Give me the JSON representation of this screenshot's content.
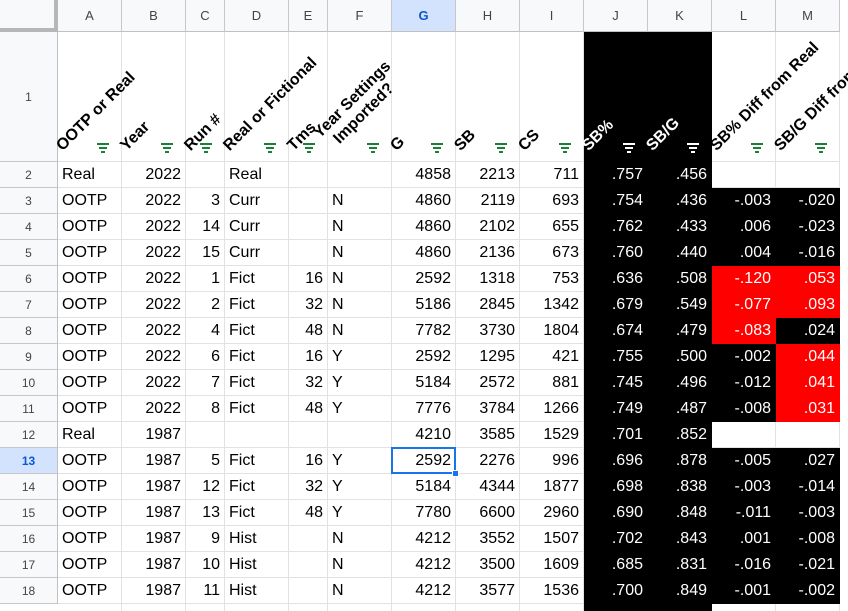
{
  "columns": [
    "A",
    "B",
    "C",
    "D",
    "E",
    "F",
    "G",
    "H",
    "I",
    "J",
    "K",
    "L",
    "M"
  ],
  "active_column": "G",
  "active_row": "13",
  "header_row_number": "1",
  "headers": [
    {
      "col": "A",
      "l1": "OOTP or Real",
      "l2": ""
    },
    {
      "col": "B",
      "l1": "Year",
      "l2": ""
    },
    {
      "col": "C",
      "l1": "Run #",
      "l2": ""
    },
    {
      "col": "D",
      "l1": "Real or Fictional",
      "l2": ""
    },
    {
      "col": "E",
      "l1": "Tms",
      "l2": ""
    },
    {
      "col": "F",
      "l1": "Year Settings",
      "l2": "Imported?"
    },
    {
      "col": "G",
      "l1": "G",
      "l2": ""
    },
    {
      "col": "H",
      "l1": "SB",
      "l2": ""
    },
    {
      "col": "I",
      "l1": "CS",
      "l2": ""
    },
    {
      "col": "J",
      "l1": "SB%",
      "l2": ""
    },
    {
      "col": "K",
      "l1": "SB/G",
      "l2": ""
    },
    {
      "col": "L",
      "l1": "SB% Diff from Real",
      "l2": ""
    },
    {
      "col": "M",
      "l1": "SB/G Diff from Real",
      "l2": ""
    }
  ],
  "rows": [
    {
      "num": "2",
      "cells": [
        "Real",
        "2022",
        "",
        "Real",
        "",
        "",
        "4858",
        "2213",
        "711",
        ".757",
        ".456",
        "",
        ""
      ]
    },
    {
      "num": "3",
      "cells": [
        "OOTP",
        "2022",
        "3",
        "Curr",
        "",
        "N",
        "4860",
        "2119",
        "693",
        ".754",
        ".436",
        "-.003",
        "-.020"
      ]
    },
    {
      "num": "4",
      "cells": [
        "OOTP",
        "2022",
        "14",
        "Curr",
        "",
        "N",
        "4860",
        "2102",
        "655",
        ".762",
        ".433",
        ".006",
        "-.023"
      ]
    },
    {
      "num": "5",
      "cells": [
        "OOTP",
        "2022",
        "15",
        "Curr",
        "",
        "N",
        "4860",
        "2136",
        "673",
        ".760",
        ".440",
        ".004",
        "-.016"
      ]
    },
    {
      "num": "6",
      "cells": [
        "OOTP",
        "2022",
        "1",
        "Fict",
        "16",
        "N",
        "2592",
        "1318",
        "753",
        ".636",
        ".508",
        "-.120",
        ".053"
      ]
    },
    {
      "num": "7",
      "cells": [
        "OOTP",
        "2022",
        "2",
        "Fict",
        "32",
        "N",
        "5186",
        "2845",
        "1342",
        ".679",
        ".549",
        "-.077",
        ".093"
      ]
    },
    {
      "num": "8",
      "cells": [
        "OOTP",
        "2022",
        "4",
        "Fict",
        "48",
        "N",
        "7782",
        "3730",
        "1804",
        ".674",
        ".479",
        "-.083",
        ".024"
      ]
    },
    {
      "num": "9",
      "cells": [
        "OOTP",
        "2022",
        "6",
        "Fict",
        "16",
        "Y",
        "2592",
        "1295",
        "421",
        ".755",
        ".500",
        "-.002",
        ".044"
      ]
    },
    {
      "num": "10",
      "cells": [
        "OOTP",
        "2022",
        "7",
        "Fict",
        "32",
        "Y",
        "5184",
        "2572",
        "881",
        ".745",
        ".496",
        "-.012",
        ".041"
      ]
    },
    {
      "num": "11",
      "cells": [
        "OOTP",
        "2022",
        "8",
        "Fict",
        "48",
        "Y",
        "7776",
        "3784",
        "1266",
        ".749",
        ".487",
        "-.008",
        ".031"
      ]
    },
    {
      "num": "12",
      "cells": [
        "Real",
        "1987",
        "",
        "",
        "",
        "",
        "4210",
        "3585",
        "1529",
        ".701",
        ".852",
        "",
        ""
      ]
    },
    {
      "num": "13",
      "cells": [
        "OOTP",
        "1987",
        "5",
        "Fict",
        "16",
        "Y",
        "2592",
        "2276",
        "996",
        ".696",
        ".878",
        "-.005",
        ".027"
      ]
    },
    {
      "num": "14",
      "cells": [
        "OOTP",
        "1987",
        "12",
        "Fict",
        "32",
        "Y",
        "5184",
        "4344",
        "1877",
        ".698",
        ".838",
        "-.003",
        "-.014"
      ]
    },
    {
      "num": "15",
      "cells": [
        "OOTP",
        "1987",
        "13",
        "Fict",
        "48",
        "Y",
        "7780",
        "6600",
        "2960",
        ".690",
        ".848",
        "-.011",
        "-.003"
      ]
    },
    {
      "num": "16",
      "cells": [
        "OOTP",
        "1987",
        "9",
        "Hist",
        "",
        "N",
        "4212",
        "3552",
        "1507",
        ".702",
        ".843",
        ".001",
        "-.008"
      ]
    },
    {
      "num": "17",
      "cells": [
        "OOTP",
        "1987",
        "10",
        "Hist",
        "",
        "N",
        "4212",
        "3500",
        "1609",
        ".685",
        ".831",
        "-.016",
        "-.021"
      ]
    },
    {
      "num": "18",
      "cells": [
        "OOTP",
        "1987",
        "11",
        "Hist",
        "",
        "N",
        "4212",
        "3577",
        "1536",
        ".700",
        ".849",
        "-.001",
        "-.002"
      ]
    }
  ],
  "red_cells": [
    "6:L",
    "6:M",
    "7:L",
    "7:M",
    "8:L",
    "9:M",
    "10:M",
    "11:M"
  ],
  "colors": {
    "black_fill": "#000000",
    "red_fill": "#ff0000",
    "selection": "#1a73e8",
    "header_bg": "#f8f9fa",
    "filter_icon": "#188038"
  }
}
